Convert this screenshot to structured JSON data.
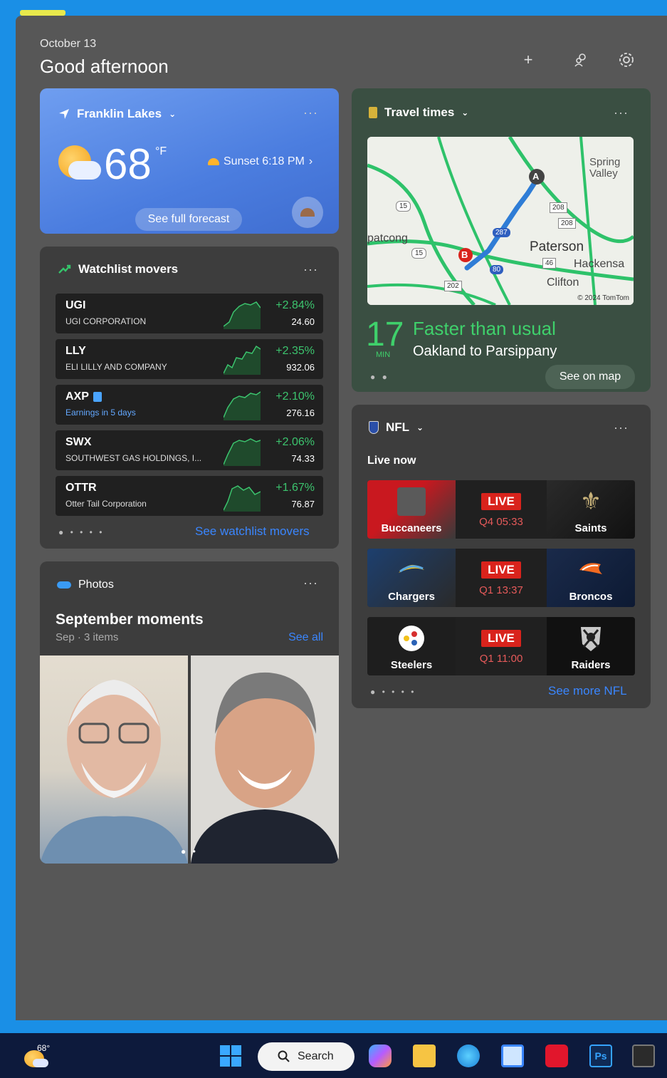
{
  "header": {
    "date": "October 13",
    "greeting": "Good afternoon"
  },
  "weather": {
    "location": "Franklin Lakes",
    "temperature": "68",
    "unit": "°F",
    "sunset": "Sunset 6:18 PM",
    "forecast_button": "See full forecast"
  },
  "travel": {
    "title": "Travel times",
    "minutes": "17",
    "minutes_label": "MIN",
    "status": "Faster than usual",
    "route": "Oakland to Parsippany",
    "see_map": "See on map",
    "map_labels": {
      "spring_valley": "Spring Valley",
      "paterson": "Paterson",
      "hackensack": "Hackensa",
      "clifton": "Clifton",
      "netcong": "patcong",
      "copyright": "© 2024 TomTom",
      "marker_a": "A",
      "marker_b": "B",
      "shield_15a": "15",
      "shield_15b": "15",
      "shield_208a": "208",
      "shield_208b": "208",
      "shield_287": "287",
      "shield_46": "46",
      "shield_80": "80",
      "shield_202": "202"
    }
  },
  "watchlist": {
    "title": "Watchlist movers",
    "see_more": "See watchlist movers",
    "stocks": [
      {
        "symbol": "UGI",
        "name": "UGI CORPORATION",
        "change": "+2.84%",
        "price": "24.60"
      },
      {
        "symbol": "LLY",
        "name": "ELI LILLY AND COMPANY",
        "change": "+2.35%",
        "price": "932.06"
      },
      {
        "symbol": "AXP",
        "name": "Earnings in 5 days",
        "change": "+2.10%",
        "price": "276.16"
      },
      {
        "symbol": "SWX",
        "name": "SOUTHWEST GAS HOLDINGS, I...",
        "change": "+2.06%",
        "price": "74.33"
      },
      {
        "symbol": "OTTR",
        "name": "Otter Tail Corporation",
        "change": "+1.67%",
        "price": "76.87"
      }
    ]
  },
  "photos": {
    "title": "Photos",
    "album": "September moments",
    "meta": "Sep · 3 items",
    "see_all": "See all"
  },
  "nfl": {
    "title": "NFL",
    "section": "Live now",
    "see_more": "See more NFL",
    "games": [
      {
        "home": "Buccaneers",
        "away": "Saints",
        "status": "LIVE",
        "clock": "Q4 05:33"
      },
      {
        "home": "Chargers",
        "away": "Broncos",
        "status": "LIVE",
        "clock": "Q1 13:37"
      },
      {
        "home": "Steelers",
        "away": "Raiders",
        "status": "LIVE",
        "clock": "Q1 11:00"
      }
    ]
  },
  "taskbar": {
    "weather_temp": "68°",
    "search_label": "Search"
  },
  "colors": {
    "accent_blue": "#1a8fe6",
    "positive": "#3cc46e",
    "travel_green": "#3fd06b",
    "live_red": "#d9231c",
    "link": "#3a86ff"
  }
}
